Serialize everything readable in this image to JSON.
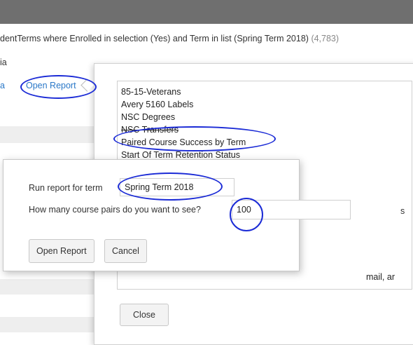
{
  "criteria": {
    "text": "dentTerms where Enrolled in selection (Yes) and Term in list (Spring Term 2018)",
    "count": "(4,783)"
  },
  "side": {
    "label": "ia",
    "link": "a",
    "open_report": "Open Report"
  },
  "report_dialog": {
    "items": [
      "85-15-Veterans",
      "Avery 5160 Labels",
      "NSC Degrees",
      "NSC Transfers",
      "Paired Course Success by Term",
      "Start Of Term Retention Status"
    ],
    "partial_item": "mail, ar",
    "tail_text": "s",
    "close_label": "Close"
  },
  "run_dialog": {
    "term_label": "Run report for term",
    "term_value": "Spring Term 2018",
    "pairs_label": "How many course pairs do you want to see?",
    "pairs_value": "100",
    "open_label": "Open Report",
    "cancel_label": "Cancel"
  },
  "colors": {
    "topbar": "#6f6f6f",
    "link": "#2a78c8",
    "annotation": "#1b2bd6"
  }
}
